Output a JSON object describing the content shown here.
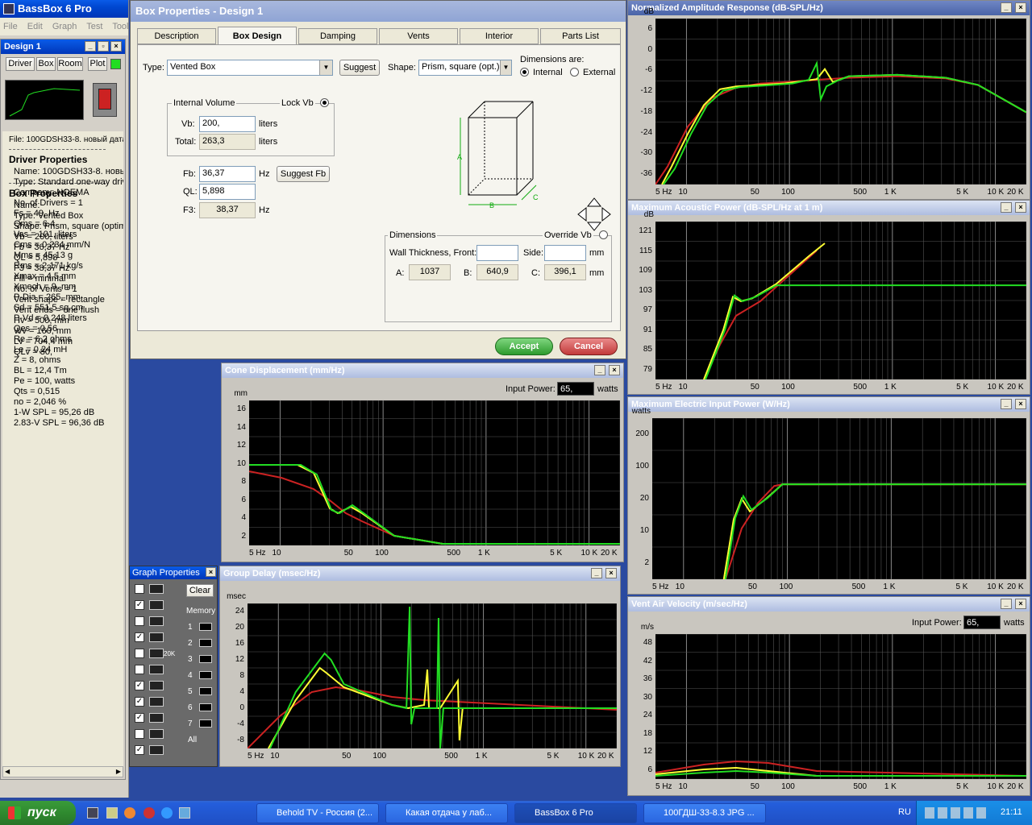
{
  "app": {
    "title": "BassBox 6 Pro",
    "menu": [
      "File",
      "Edit",
      "Graph",
      "Test",
      "Tools"
    ]
  },
  "design": {
    "title": "Design 1",
    "buttons": [
      "Driver",
      "Box",
      "Room",
      "Plot"
    ],
    "file": "File: 100GDSH33-8. новый даташ",
    "driver_header": "Driver Properties",
    "driver_lines": [
      "Name: 100GDSH33-8. новы",
      "Type: Standard one-way driv",
      "Company: NOEMA",
      "No. of Drivers = 1",
      "Fs = 49, Hz",
      "Qms = 6,4",
      "Vas = 101, liters",
      "Cms = 0,234 mm/N",
      "Mms = 45,13 g",
      "Rms = 2,171 kg/s",
      "Xmax = 4,5 mm",
      "Xmech = 9, mm",
      "P-Dia = 265, mm",
      "Sd = 551,5 sq.cm",
      "P-Vd = 0,248 liters",
      "Qes = 0,56",
      "Re = 6,2 ohms",
      "Le = 0,24 mH",
      "Z = 8, ohms",
      "BL = 12,4 Tm",
      "Pe = 100, watts",
      "Qts = 0,515",
      "no = 2,046 %",
      "1-W SPL = 95,26 dB",
      "2.83-V SPL = 96,36 dB"
    ],
    "box_header": "Box Properties",
    "box_lines": [
      "Name:",
      "Type: Vented Box",
      "Shape: Prism, square (optimu",
      "Vb = 200, liters",
      "Fb = 36,37 Hz",
      "QL = 5,898",
      "F3 = 38,37 Hz",
      "Fill = minimal",
      "No. of Vents = 1",
      "Vent shape = rectangle",
      "Vent ends = one flush",
      "Hv = 500, mm",
      "Wv = 160, mm",
      "Lv = 704,4 mm",
      "QLv = 80,"
    ]
  },
  "box_dialog": {
    "title": "Box Properties - Design 1",
    "tabs": [
      "Description",
      "Box Design",
      "Damping",
      "Vents",
      "Interior",
      "Parts List"
    ],
    "type_label": "Type:",
    "type_value": "Vented Box",
    "suggest": "Suggest",
    "shape_label": "Shape:",
    "shape_value": "Prism, square (opt.)",
    "dims_are": "Dimensions are:",
    "internal": "Internal",
    "external": "External",
    "internal_volume": "Internal Volume",
    "lock_vb": "Lock Vb",
    "vb_label": "Vb:",
    "vb_value": "200,",
    "liters": "liters",
    "total_label": "Total:",
    "total_value": "263,3",
    "fb_label": "Fb:",
    "fb_value": "36,37",
    "hz": "Hz",
    "suggest_fb": "Suggest Fb",
    "ql_label": "QL:",
    "ql_value": "5,898",
    "f3_label": "F3:",
    "f3_value": "38,37",
    "dimensions": "Dimensions",
    "override_vb": "Override Vb",
    "wall_front": "Wall Thickness, Front:",
    "side": "Side:",
    "mm": "mm",
    "a_label": "A:",
    "a_value": "1037",
    "b_label": "B:",
    "b_value": "640,9",
    "c_label": "C:",
    "c_value": "396,1",
    "accept": "Accept",
    "cancel": "Cancel",
    "dim_letters": [
      "A",
      "B",
      "C"
    ]
  },
  "graphs": {
    "amplitude": {
      "title": "Normalized Amplitude Response (dB-SPL/Hz)",
      "unit": "dB",
      "yticks": [
        "6",
        "0",
        "-6",
        "-12",
        "-18",
        "-24",
        "-30",
        "-36"
      ]
    },
    "acoustic": {
      "title": "Maximum Acoustic Power (dB-SPL/Hz at 1 m)",
      "unit": "dB",
      "yticks": [
        "121",
        "115",
        "109",
        "103",
        "97",
        "91",
        "85",
        "79"
      ]
    },
    "electric": {
      "title": "Maximum Electric Input Power (W/Hz)",
      "unit": "watts",
      "yticks": [
        "200",
        "100",
        "20",
        "10",
        "2"
      ]
    },
    "vent": {
      "title": "Vent Air Velocity (m/sec/Hz)",
      "unit": "m/s",
      "input_power_label": "Input Power:",
      "input_power": "65,",
      "watts": "watts",
      "yticks": [
        "48",
        "42",
        "36",
        "30",
        "24",
        "18",
        "12",
        "6"
      ]
    },
    "cone": {
      "title": "Cone Displacement (mm/Hz)",
      "unit": "mm",
      "input_power_label": "Input Power:",
      "input_power": "65,",
      "watts": "watts",
      "yticks": [
        "16",
        "14",
        "12",
        "10",
        "8",
        "6",
        "4",
        "2"
      ]
    },
    "delay": {
      "title": "Group Delay (msec/Hz)",
      "unit": "msec",
      "yticks": [
        "24",
        "20",
        "16",
        "12",
        "8",
        "4",
        "0",
        "-4",
        "-8"
      ]
    },
    "xticks": [
      "5 Hz",
      "10",
      "50",
      "100",
      "500",
      "1 K",
      "5 K",
      "10 K",
      "20 K"
    ]
  },
  "graph_props": {
    "title": "Graph Properties",
    "clear": "Clear",
    "memory": "Memory",
    "slots": [
      "1",
      "2",
      "3",
      "4",
      "5",
      "6",
      "7",
      "All"
    ],
    "zoom_label": "20K"
  },
  "taskbar": {
    "start": "пуск",
    "items": [
      "Behold TV - Россия (2...",
      "Какая отдача у лаб...",
      "BassBox 6 Pro",
      "100ГДШ-33-8.3 JPG ..."
    ],
    "lang": "RU",
    "time": "21:11"
  },
  "colors": {
    "green": "#22dd22",
    "yellow": "#ffff33",
    "red": "#cc2222",
    "grid": "#555555"
  }
}
